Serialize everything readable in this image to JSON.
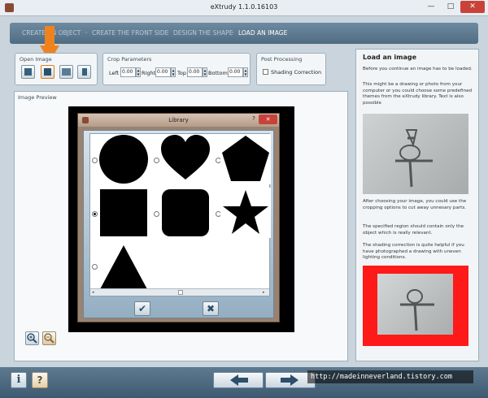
{
  "window": {
    "title": "eXtrudy 1.1.0.16103",
    "minimize": "—",
    "maximize": "□",
    "close": "✕"
  },
  "steps": [
    {
      "label": "CREATE AN OBJECT"
    },
    {
      "label": "CREATE THE FRONT SIDE"
    },
    {
      "label": "DESIGN THE SHAPE"
    },
    {
      "label": "LOAD AN IMAGE"
    }
  ],
  "open_image": {
    "label": "Open Image"
  },
  "crop": {
    "label": "Crop Parameters",
    "left_label": "Left",
    "left_value": "0.00",
    "right_label": "Right",
    "right_value": "0.00",
    "top_label": "Top",
    "top_value": "0.00",
    "bottom_label": "Bottom",
    "bottom_value": "0.00",
    "spin_up": "▲",
    "spin_down": "▼"
  },
  "post": {
    "label": "Post Processing",
    "shading_label": "Shading Correction",
    "shading_checked": false
  },
  "preview": {
    "label": "Image Preview"
  },
  "library": {
    "title": "Library",
    "help": "?",
    "close": "✕",
    "shapes": [
      {
        "name": "circle",
        "selected": false
      },
      {
        "name": "heart",
        "selected": false
      },
      {
        "name": "pentagon",
        "selected": false
      },
      {
        "name": "square",
        "selected": true
      },
      {
        "name": "rounded-square",
        "selected": false
      },
      {
        "name": "star",
        "selected": false
      },
      {
        "name": "triangle",
        "selected": false
      }
    ],
    "ok_icon": "✔",
    "cancel_icon": "✖"
  },
  "info": {
    "title": "Load an image",
    "p1": "Before you continue an image has to be loaded.",
    "p2": "This might be a drawing or photo from your computer or you could choose some predefined themes from the eXtrudy library. Text is also possible",
    "p3": "After choosing your image, you could use the cropping options to cut away unnesary parts.",
    "p4": "The specified region should contain only the object which is really relevant.",
    "p5": "The shading correction is quite helpful if you have photographed a drawing with uneven lighting conditions."
  },
  "watermark": "http://madeinneverland.tistory.com",
  "colors": {
    "accent_arrow": "#f0821e",
    "crop_highlight": "#ff1a1a",
    "steps_bar": "#5b7890"
  }
}
